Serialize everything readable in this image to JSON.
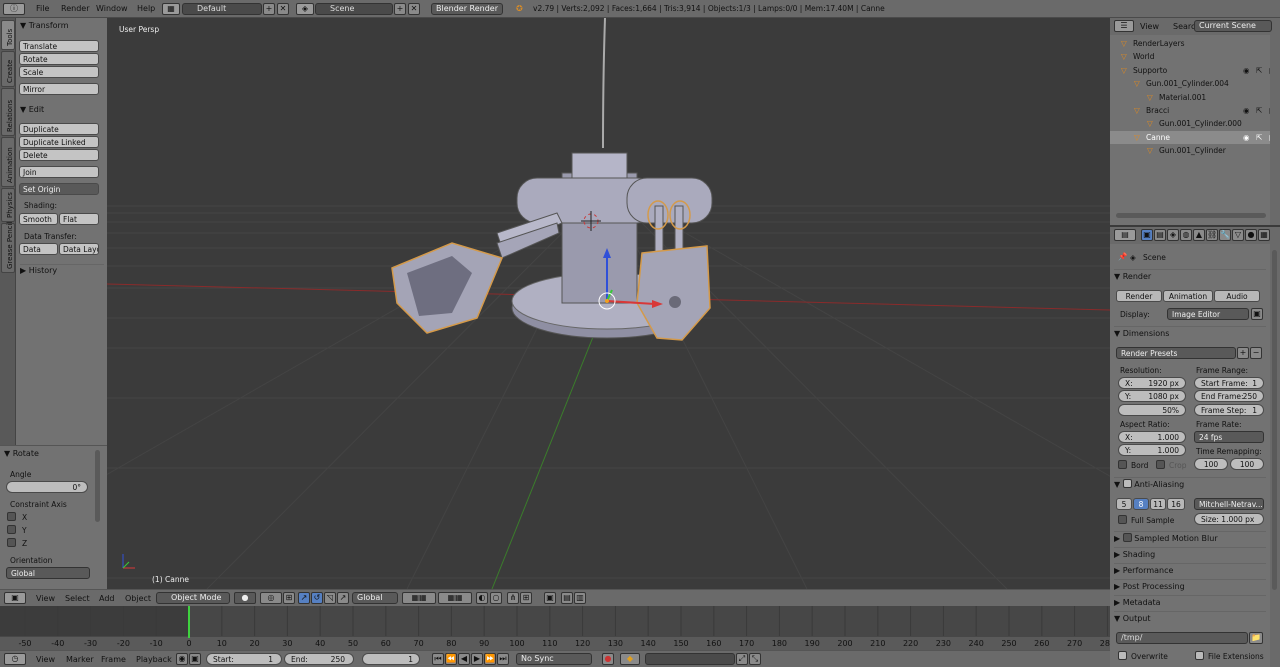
{
  "topbar": {
    "menus": [
      "File",
      "Render",
      "Window",
      "Help"
    ],
    "screen_layout": "Default",
    "scene": "Scene",
    "engine": "Blender Render",
    "stats": "v2.79 | Verts:2,092 | Faces:1,664 | Tris:3,914 | Objects:1/3 | Lamps:0/0 | Mem:17.40M | Canne"
  },
  "toolshelf": {
    "tabs": [
      "Tools",
      "Create",
      "Relations",
      "Animation",
      "Physics",
      "Grease Pencil"
    ],
    "transform_title": "Transform",
    "transform": [
      "Translate",
      "Rotate",
      "Scale",
      "Mirror"
    ],
    "edit_title": "Edit",
    "edit": [
      "Duplicate",
      "Duplicate Linked",
      "Delete",
      "Join"
    ],
    "set_origin": "Set Origin",
    "shading_label": "Shading:",
    "smooth": "Smooth",
    "flat": "Flat",
    "data_transfer_label": "Data Transfer:",
    "data": "Data",
    "data_layout": "Data Layo",
    "history": "History"
  },
  "operator": {
    "title": "Rotate",
    "angle_label": "Angle",
    "angle_value": "0°",
    "constraint_label": "Constraint Axis",
    "axes": [
      "X",
      "Y",
      "Z"
    ],
    "orientation_label": "Orientation",
    "orientation_value": "Global"
  },
  "viewport": {
    "view_label": "User Persp",
    "object_label": "(1) Canne"
  },
  "vp_header": {
    "menus": [
      "View",
      "Select",
      "Add",
      "Object"
    ],
    "mode": "Object Mode",
    "orientation": "Global"
  },
  "timeline": {
    "ticks": [
      "-50",
      "-40",
      "-30",
      "-20",
      "-10",
      "0",
      "10",
      "20",
      "30",
      "40",
      "50",
      "60",
      "70",
      "80",
      "90",
      "100",
      "110",
      "120",
      "130",
      "140",
      "150",
      "160",
      "170",
      "180",
      "190",
      "200",
      "210",
      "220",
      "230",
      "240",
      "250",
      "260",
      "270",
      "280"
    ],
    "current_frame_marker": 0,
    "menus": [
      "View",
      "Marker",
      "Frame",
      "Playback"
    ],
    "start_label": "Start:",
    "start": "1",
    "end_label": "End:",
    "end": "250",
    "current": "1",
    "sync": "No Sync"
  },
  "outliner": {
    "menus": [
      "View",
      "Search"
    ],
    "scope": "Current Scene",
    "items": [
      {
        "label": "RenderLayers",
        "indent": 0
      },
      {
        "label": "World",
        "indent": 0
      },
      {
        "label": "Supporto",
        "indent": 0
      },
      {
        "label": "Gun.001_Cylinder.004",
        "indent": 1
      },
      {
        "label": "Material.001",
        "indent": 2
      },
      {
        "label": "Bracci",
        "indent": 1
      },
      {
        "label": "Gun.001_Cylinder.000",
        "indent": 2
      },
      {
        "label": "Canne",
        "indent": 1
      },
      {
        "label": "Gun.001_Cylinder",
        "indent": 2
      }
    ],
    "selected_index": 7
  },
  "properties": {
    "context": "Scene",
    "render_title": "Render",
    "render_btn": "Render",
    "animation_btn": "Animation",
    "audio_btn": "Audio",
    "display_label": "Display:",
    "display_value": "Image Editor",
    "dimensions_title": "Dimensions",
    "presets": "Render Presets",
    "resolution_label": "Resolution:",
    "res_x": "X:",
    "res_x_val": "1920 px",
    "res_y": "Y:",
    "res_y_val": "1080 px",
    "res_pct": "50%",
    "frame_range_label": "Frame Range:",
    "start_frame": "Start Frame:",
    "start_frame_val": "1",
    "end_frame": "End Frame:",
    "end_frame_val": "250",
    "frame_step": "Frame Step:",
    "frame_step_val": "1",
    "aspect_label": "Aspect Ratio:",
    "asp_x": "X:",
    "asp_x_val": "1.000",
    "asp_y": "Y:",
    "asp_y_val": "1.000",
    "frame_rate_label": "Frame Rate:",
    "frame_rate": "24 fps",
    "bord": "Bord",
    "crop": "Crop",
    "time_remap_label": "Time Remapping:",
    "remap_old": "100",
    "remap_new": "100",
    "aa_title": "Anti-Aliasing",
    "aa_samples": [
      "5",
      "8",
      "11",
      "16"
    ],
    "aa_filter": "Mitchell-Netrav...",
    "full_sample": "Full Sample",
    "size": "Size: 1.000 px",
    "sections": [
      "Sampled Motion Blur",
      "Shading",
      "Performance",
      "Post Processing",
      "Metadata",
      "Output"
    ],
    "output_path": "/tmp/",
    "overwrite": "Overwrite",
    "file_ext": "File Extensions"
  }
}
